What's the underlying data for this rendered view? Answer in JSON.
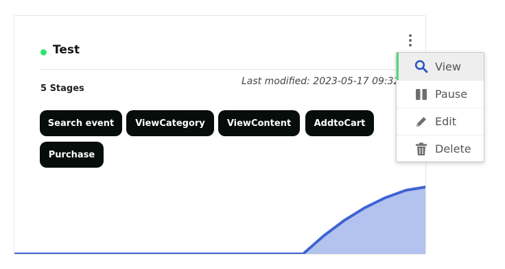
{
  "card": {
    "title": "Test",
    "status_color": "#2ee56b",
    "stages_count": "5 Stages",
    "last_modified": "Last modified: 2023-05-17 09:32",
    "stages": [
      "Search event",
      "ViewCategory",
      "ViewContent",
      "AddtoCart",
      "Purchase"
    ]
  },
  "menu": {
    "items": [
      {
        "label": "View",
        "icon": "search-icon"
      },
      {
        "label": "Pause",
        "icon": "pause-icon"
      },
      {
        "label": "Edit",
        "icon": "pencil-icon"
      },
      {
        "label": "Delete",
        "icon": "trash-icon"
      }
    ],
    "active_item": "View",
    "accent_color": "#4cdb7a"
  },
  "chart_data": {
    "type": "area",
    "x": [
      0,
      1,
      2,
      3,
      4,
      5,
      6,
      7,
      8,
      9,
      10,
      11,
      12,
      13,
      14,
      15,
      16,
      17,
      18,
      19,
      20
    ],
    "values": [
      0,
      0,
      0,
      0,
      0,
      0,
      0,
      0,
      0,
      0,
      0,
      0,
      0,
      0,
      0,
      0.27,
      0.5,
      0.69,
      0.84,
      0.95,
      1.0
    ],
    "line_color": "#3f63d2",
    "fill_color": "#b3c3ef",
    "axes_visible": false
  }
}
